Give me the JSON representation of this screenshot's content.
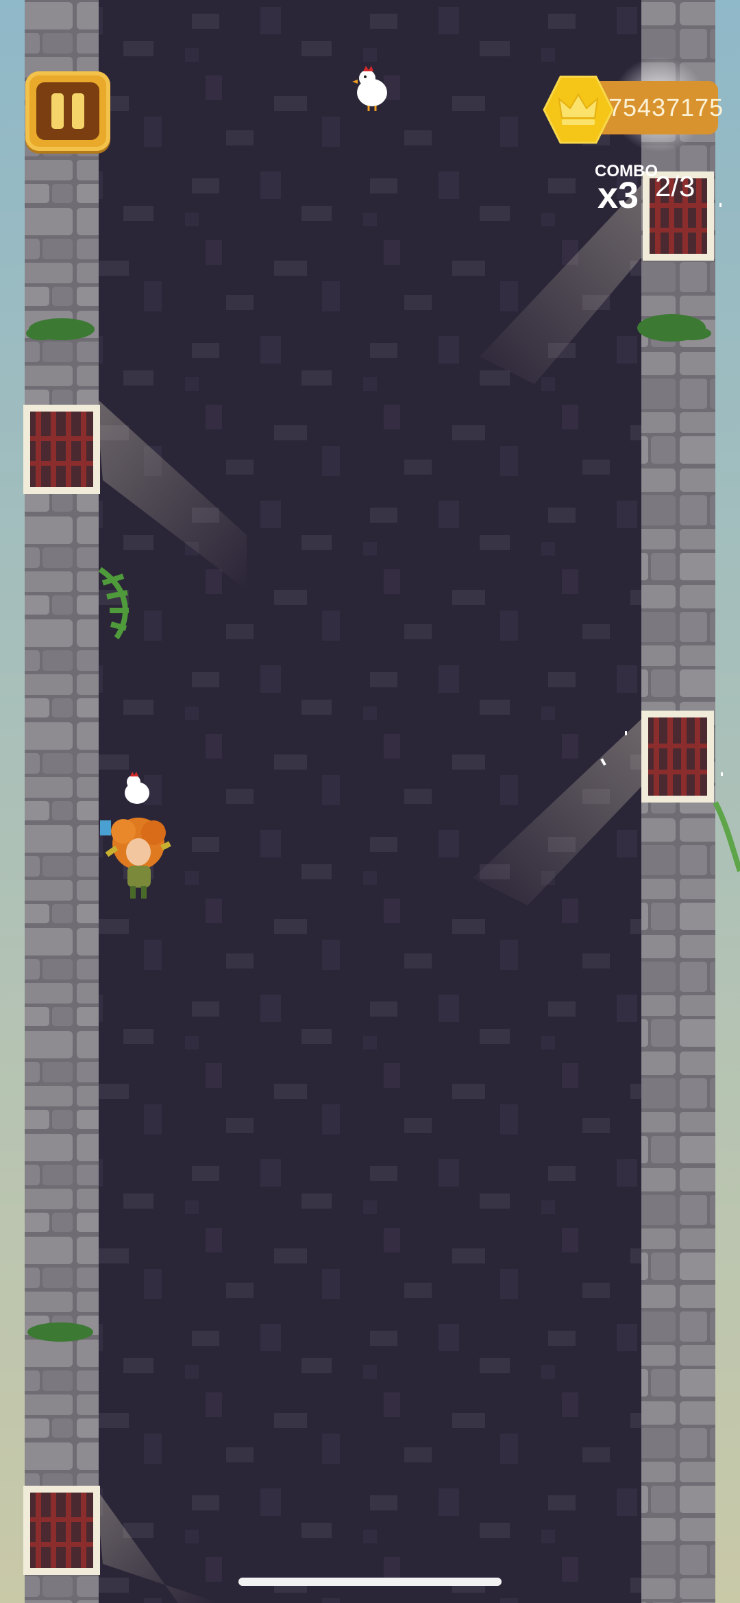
{
  "hud": {
    "score": "75437175",
    "combo_label": "COMBO",
    "combo_multiplier": "x3",
    "combo_progress": "2/3"
  },
  "icons": {
    "pause": "pause-icon",
    "score_badge": "crown-icon",
    "target": "chicken-icon"
  },
  "colors": {
    "background": "#2b2538",
    "stone": "#8d8a8f",
    "score_pill": "#d9932e",
    "badge": "#f5c518",
    "pause_frame": "#e9a92a",
    "window_bars": "#7a2a2a"
  }
}
